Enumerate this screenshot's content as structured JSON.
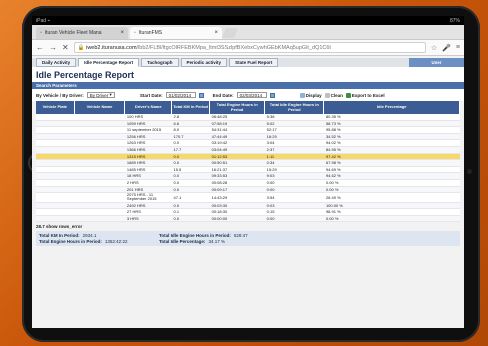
{
  "status_bar": {
    "left": "iPad ⌁",
    "center": "",
    "right": "87%"
  },
  "browser_tabs": [
    {
      "label": "Ituran Vehicle Fleet Mana",
      "active": false
    },
    {
      "label": "IturanFMS",
      "active": true
    }
  ],
  "url": {
    "host": "iweb2.ituranusa.com",
    "path": "/lbb2/FLBl/ltgcOlRFEBKMpa_ltmt3SSzlpfBXebxCywhGEbKMAq5upGlt_dQ1C6t"
  },
  "app_tabs": [
    "Daily Activity",
    "Idle Percentage Report",
    "Tachograph",
    "Periodic activity",
    "State Fuel Report"
  ],
  "user_tab": "User",
  "page_title": "Idle Percentage Report",
  "search_label": "Search Parameters",
  "filters": {
    "by_label": "By Vehicle / By Driver:",
    "by_value": "By Driver",
    "start_label": "Start Date:",
    "start_value": "01/02/2014",
    "end_label": "End Date:",
    "end_value": "02/03/2014",
    "display": "Display",
    "clean": "Clean",
    "export": "Export to Excel"
  },
  "table": {
    "columns": [
      "Vehicle Plate",
      "Vehicle Name",
      "Driver's Name",
      "Total KM in Period",
      "Total Engine Hours in Period",
      "Total Idle Engine Hours in Period",
      "Idle Percentage"
    ],
    "rows": [
      [
        "",
        "",
        "100 HRS",
        "2.8",
        "06:48:25",
        "5:38",
        "80.35 %"
      ],
      [
        "",
        "",
        "1059 HRS",
        "6.6",
        "07:58:19",
        "5:02",
        "58.73 %"
      ],
      [
        "",
        "",
        "11 september 2015",
        "8.0",
        "54:31:44",
        "52:17",
        "95.88 %"
      ],
      [
        "",
        "",
        "1256 HRS",
        "170.7",
        "47:44:49",
        "16:29",
        "34.52 %"
      ],
      [
        "",
        "",
        "1263 HRS",
        "0.0",
        "03:19:42",
        "3:04",
        "94.02 %"
      ],
      [
        "",
        "",
        "1366 HRS",
        "17.7",
        "03:04:49",
        "2:37",
        "84.95 %"
      ],
      [
        "",
        "",
        "1315 HRS",
        "0.0",
        "01:12:53",
        "1:11",
        "97.42 %"
      ],
      [
        "",
        "",
        "1689 HRS",
        "0.0",
        "00:50:51",
        "0:34",
        "67.98 %"
      ],
      [
        "",
        "",
        "1485 HRS",
        "15.5",
        "16:21:37",
        "15:29",
        "94.69 %"
      ],
      [
        "",
        "",
        "18 HRS",
        "0.0",
        "09:33:53",
        "9:03",
        "94.62 %"
      ],
      [
        "",
        "",
        "2 HRS",
        "0.0",
        "00:08:28",
        "0:00",
        "0.00 %"
      ],
      [
        "",
        "",
        "201 HRS",
        "0.0",
        "00:09:17",
        "0:00",
        "0.00 %"
      ],
      [
        "",
        "",
        "2075 HRS - 11 September 2015",
        "47.1",
        "14:43:29",
        "3:54",
        "26.49 %"
      ],
      [
        "",
        "",
        "2492 HRS",
        "0.0",
        "00:03:30",
        "0:03",
        "100.00 %"
      ],
      [
        "",
        "",
        "27 HRS",
        "0.1",
        "00:18:30",
        "0:15",
        "98.91 %"
      ],
      [
        "",
        "",
        "3 HRS",
        "0.0",
        "00:00:00",
        "0:00",
        "0.00 %"
      ]
    ],
    "highlight_index": 6
  },
  "footer_count": "28.7 show rows_error",
  "totals": {
    "km_label": "Total KM In Period:",
    "km_value": "2934.1",
    "engine_label": "Total Engine Hours in Period:",
    "engine_value": "1352:42:22",
    "idle_label": "Total Idle Engine Hours in Period:",
    "idle_value": "528:47",
    "pct_label": "Total Idle Percentage:",
    "pct_value": "34.17 %"
  }
}
